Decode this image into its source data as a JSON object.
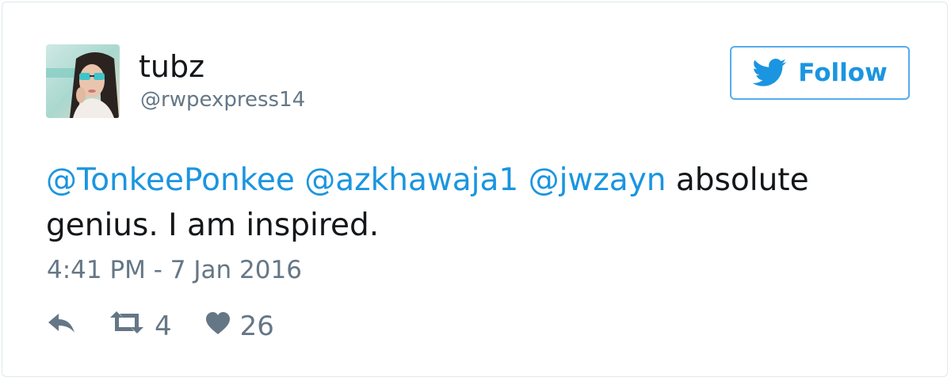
{
  "user": {
    "display_name": "tubz",
    "screen_name": "@rwpexpress14",
    "avatar_icon": "profile-photo"
  },
  "follow_button": {
    "label": "Follow",
    "icon": "twitter-bird-icon",
    "color": "#1b95e0",
    "border_color": "#55acee"
  },
  "tweet": {
    "mentions": [
      "@TonkeePonkee",
      "@azkhawaja1",
      "@jwzayn"
    ],
    "text_line1_rest": "absolute",
    "text_line2": "genius. I am inspired.",
    "timestamp": "4:41 PM - 7 Jan 2016"
  },
  "actions": {
    "reply_icon": "reply-icon",
    "retweet_icon": "retweet-icon",
    "retweet_count": "4",
    "like_icon": "heart-icon",
    "like_count": "26"
  },
  "colors": {
    "link": "#1b95e0",
    "text": "#14171a",
    "secondary": "#657786",
    "border": "#e1e8ed"
  }
}
